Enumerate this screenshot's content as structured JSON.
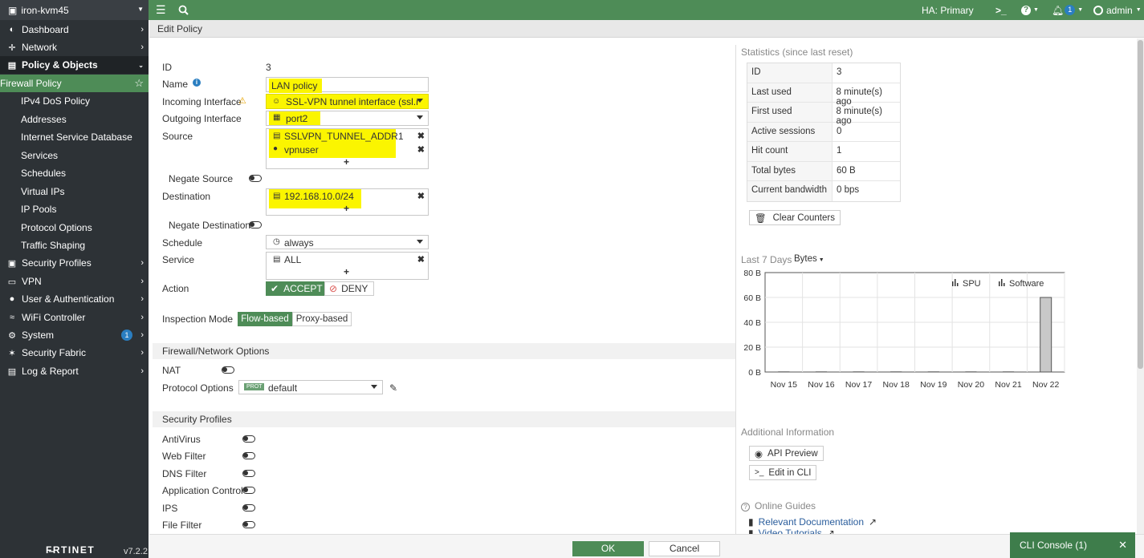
{
  "topbar": {
    "device_name": "iron-kvm45",
    "ha_status": "HA: Primary",
    "cli_icon": ">_",
    "notification_count": "1",
    "user": "admin"
  },
  "sidebar": {
    "items": [
      {
        "label": "Dashboard",
        "icon": "dashboard-icon"
      },
      {
        "label": "Network",
        "icon": "network-icon"
      },
      {
        "label": "Policy & Objects",
        "icon": "policy-icon"
      },
      {
        "label": "Firewall Policy"
      },
      {
        "label": "IPv4 DoS Policy"
      },
      {
        "label": "Addresses"
      },
      {
        "label": "Internet Service Database"
      },
      {
        "label": "Services"
      },
      {
        "label": "Schedules"
      },
      {
        "label": "Virtual IPs"
      },
      {
        "label": "IP Pools"
      },
      {
        "label": "Protocol Options"
      },
      {
        "label": "Traffic Shaping"
      },
      {
        "label": "Security Profiles",
        "icon": "lock-icon"
      },
      {
        "label": "VPN",
        "icon": "vpn-icon"
      },
      {
        "label": "User & Authentication",
        "icon": "user-icon"
      },
      {
        "label": "WiFi Controller",
        "icon": "wifi-icon"
      },
      {
        "label": "System",
        "icon": "gear-icon",
        "badge": "1"
      },
      {
        "label": "Security Fabric",
        "icon": "fabric-icon"
      },
      {
        "label": "Log & Report",
        "icon": "chart-icon"
      }
    ],
    "logo": "F̶RTINET",
    "version": "v7.2.2"
  },
  "header": {
    "title": "Edit Policy"
  },
  "form": {
    "id_label": "ID",
    "id_value": "3",
    "name_label": "Name",
    "name_value": "LAN policy",
    "incoming_label": "Incoming Interface",
    "incoming_value": "SSL-VPN tunnel interface (ssl.roo",
    "outgoing_label": "Outgoing Interface",
    "outgoing_value": "port2",
    "source_label": "Source",
    "source_items": [
      "SSLVPN_TUNNEL_ADDR1",
      "vpnuser"
    ],
    "negate_source_label": "Negate Source",
    "destination_label": "Destination",
    "destination_items": [
      "192.168.10.0/24"
    ],
    "negate_destination_label": "Negate Destination",
    "schedule_label": "Schedule",
    "schedule_value": "always",
    "service_label": "Service",
    "service_items": [
      "ALL"
    ],
    "action_label": "Action",
    "accept_label": "ACCEPT",
    "deny_label": "DENY",
    "inspection_label": "Inspection Mode",
    "flow_label": "Flow-based",
    "proxy_label": "Proxy-based",
    "fw_section": "Firewall/Network Options",
    "nat_label": "NAT",
    "protocol_options_label": "Protocol Options",
    "protocol_tag": "PROT",
    "protocol_value": "default",
    "sec_section": "Security Profiles",
    "profiles": [
      "AntiVirus",
      "Web Filter",
      "DNS Filter",
      "Application Control",
      "IPS",
      "File Filter"
    ]
  },
  "stats": {
    "title": "Statistics (since last reset)",
    "rows": [
      {
        "k": "ID",
        "v": "3"
      },
      {
        "k": "Last used",
        "v": "8 minute(s) ago"
      },
      {
        "k": "First used",
        "v": "8 minute(s) ago"
      },
      {
        "k": "Active sessions",
        "v": "0"
      },
      {
        "k": "Hit count",
        "v": "1"
      },
      {
        "k": "Total bytes",
        "v": "60 B"
      },
      {
        "k": "Current bandwidth",
        "v": "0 bps"
      }
    ],
    "clear_label": "Clear Counters"
  },
  "chart_data": {
    "type": "bar",
    "title": "Last 7 Days",
    "metric": "Bytes",
    "categories": [
      "Nov 15",
      "Nov 16",
      "Nov 17",
      "Nov 18",
      "Nov 19",
      "Nov 20",
      "Nov 21",
      "Nov 22"
    ],
    "series": [
      {
        "name": "SPU",
        "values": [
          0,
          0,
          0,
          0,
          0,
          0,
          0,
          0
        ]
      },
      {
        "name": "Software",
        "values": [
          0,
          0,
          0,
          0,
          0,
          0,
          0,
          60
        ]
      }
    ],
    "yticks": [
      "0 B",
      "20 B",
      "40 B",
      "60 B",
      "80 B"
    ],
    "ylim": [
      0,
      80
    ],
    "legend": "top-right",
    "grid": true,
    "colors": {
      "bar": "#c8c8c8"
    }
  },
  "additional": {
    "title": "Additional Information",
    "api_label": "API Preview",
    "cli_label": "Edit in CLI",
    "guides_title": "Online Guides",
    "doc_link": "Relevant Documentation",
    "video_link": "Video Tutorials"
  },
  "footer": {
    "ok_label": "OK",
    "cancel_label": "Cancel",
    "cli_console": "CLI Console (1)"
  },
  "colors": {
    "brand": "#4e8c57",
    "sidebar": "#2d3236",
    "highlight": "#fbf500"
  }
}
